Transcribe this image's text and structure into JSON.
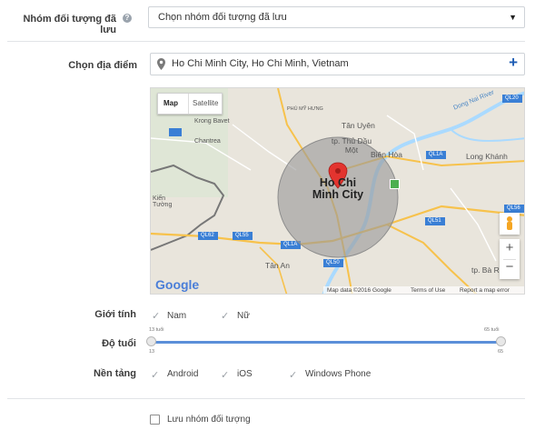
{
  "saved_audience": {
    "label": "Nhóm đối tượng đã lưu",
    "help_glyph": "?",
    "select_value": "Chọn nhóm đối tượng đã lưu",
    "arrow": "▼"
  },
  "location": {
    "label": "Chọn địa điểm",
    "value": "Ho Chi Minh City, Ho Chi Minh, Vietnam",
    "add_glyph": "+"
  },
  "map": {
    "type_map": "Map",
    "type_satellite": "Satellite",
    "place_labels": [
      "Krong Bavet",
      "Chantrea",
      "Tân Uyên",
      "tp. Thủ Dầu Một",
      "Biên Hòa",
      "Long Khánh",
      "Tân An",
      "tp. Bà Rịa",
      "Kiến Tường",
      "PHÚ MỸ HƯNG",
      "Dong Nai River"
    ],
    "center_label_line1": "Ho Chi",
    "center_label_line2": "Minh City",
    "road_labels": [
      "QL20",
      "QL1A",
      "QL56",
      "QL51",
      "QL62",
      "QL1A",
      "QL50",
      "QL55"
    ],
    "google": "Google",
    "footer": [
      "Map data ©2016 Google",
      "Terms of Use",
      "Report a map error"
    ],
    "zoom_in": "+",
    "zoom_out": "−",
    "accent": "#9a9a9a",
    "water": "#aadaff",
    "road_color": "#f7c24c"
  },
  "gender": {
    "label": "Giới tính",
    "options": [
      "Nam",
      "Nữ"
    ],
    "check_glyph": "✓"
  },
  "age": {
    "label": "Độ tuổi",
    "min_top": "13 tuổi",
    "max_top": "65 tuổi",
    "min_value": "13",
    "max_value": "65",
    "range": [
      13,
      65
    ],
    "accent": "#5b8fd9"
  },
  "platform": {
    "label": "Nền tảng",
    "options": [
      "Android",
      "iOS",
      "Windows Phone"
    ]
  },
  "save": {
    "label": "Lưu nhóm đối tượng"
  }
}
